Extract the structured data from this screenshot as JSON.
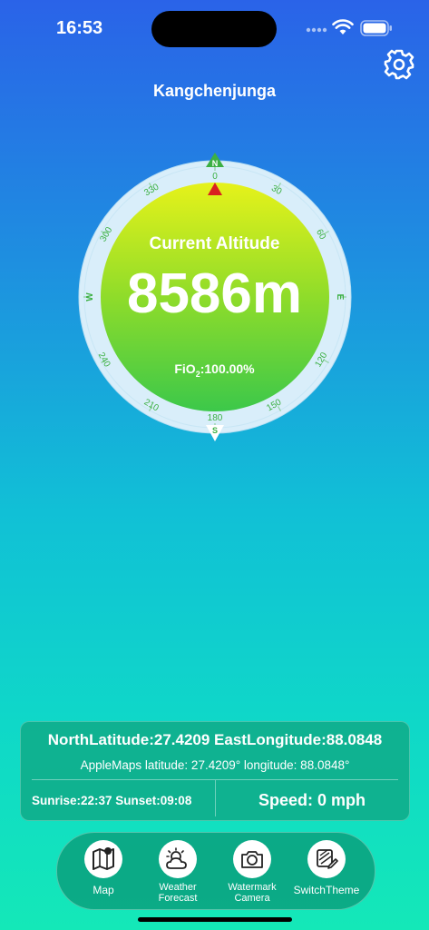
{
  "status": {
    "time": "16:53"
  },
  "header": {
    "location_name": "Kangchenjunga",
    "settings_icon": "gear-icon"
  },
  "compass": {
    "north_letter": "N",
    "south_letter": "S",
    "east_letter": "E",
    "west_letter": "W",
    "degree_labels": [
      "0",
      "30",
      "60",
      "120",
      "150",
      "180",
      "210",
      "240",
      "300",
      "330"
    ],
    "altitude_label": "Current Altitude",
    "altitude_value": "8586m",
    "fio2_prefix": "FiO",
    "fio2_sub": "2",
    "fio2_value": ":100.00%",
    "colors": {
      "panel_top": "#e6f21a",
      "panel_bottom": "#3cc84a",
      "ring": "#d9eefa",
      "north_marker": "#3cb043",
      "pointer": "#d92020"
    }
  },
  "info": {
    "coords_text": "NorthLatitude:27.4209 EastLongitude:88.0848",
    "apple_coords_text": "AppleMaps latitude: 27.4209° longitude: 88.0848°",
    "sun_text": "Sunrise:22:37 Sunset:09:08",
    "speed_text": "Speed: 0 mph"
  },
  "dock": {
    "items": [
      {
        "label": "Map",
        "icon": "map-icon"
      },
      {
        "label_line1": "Weather",
        "label_line2": "Forecast",
        "icon": "weather-icon"
      },
      {
        "label_line1": "Watermark",
        "label_line2": "Camera",
        "icon": "camera-icon"
      },
      {
        "label": "SwitchTheme",
        "icon": "theme-icon"
      }
    ]
  }
}
